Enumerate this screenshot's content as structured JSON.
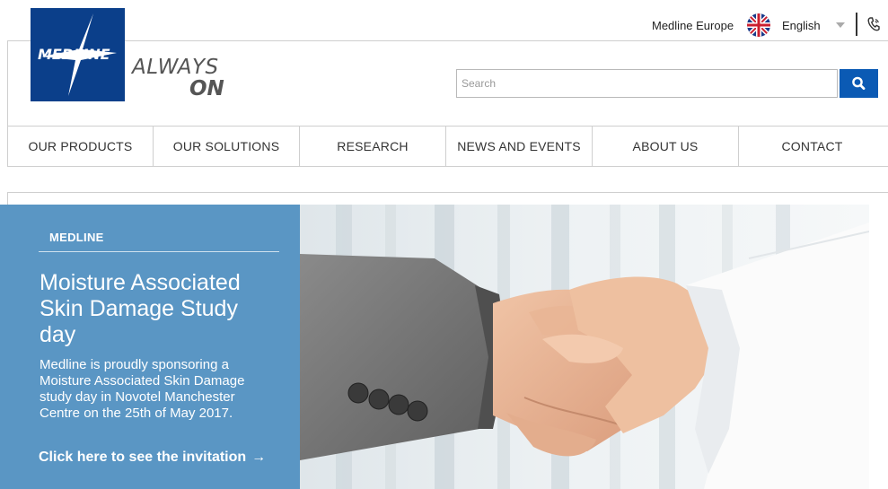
{
  "brand": {
    "logo_text": "MEDLINE",
    "tagline_line1": "ALWAYS",
    "tagline_line2": "ON",
    "color_primary": "#0b3f8a"
  },
  "topbar": {
    "region": "Medline Europe",
    "language": "English",
    "flag_icon": "uk-flag-icon",
    "phone_icon": "phone-icon"
  },
  "search": {
    "placeholder": "Search",
    "value": "",
    "button_icon": "search-icon",
    "button_color": "#0b5ab4"
  },
  "nav": {
    "items": [
      {
        "label": "OUR PRODUCTS"
      },
      {
        "label": "OUR SOLUTIONS"
      },
      {
        "label": "RESEARCH"
      },
      {
        "label": "NEWS AND EVENTS"
      },
      {
        "label": "ABOUT US"
      },
      {
        "label": "CONTACT"
      }
    ]
  },
  "hero": {
    "kicker": "MEDLINE",
    "title": "Moisture Associated Skin Damage Study day",
    "body": "Medline is proudly sponsoring a Moisture Associated Skin Damage study day in Novotel Manchester Centre on the 25th of May 2017.",
    "link_label": "Click here to see the invitation",
    "link_arrow": "→",
    "panel_color": "#5a96c4"
  }
}
